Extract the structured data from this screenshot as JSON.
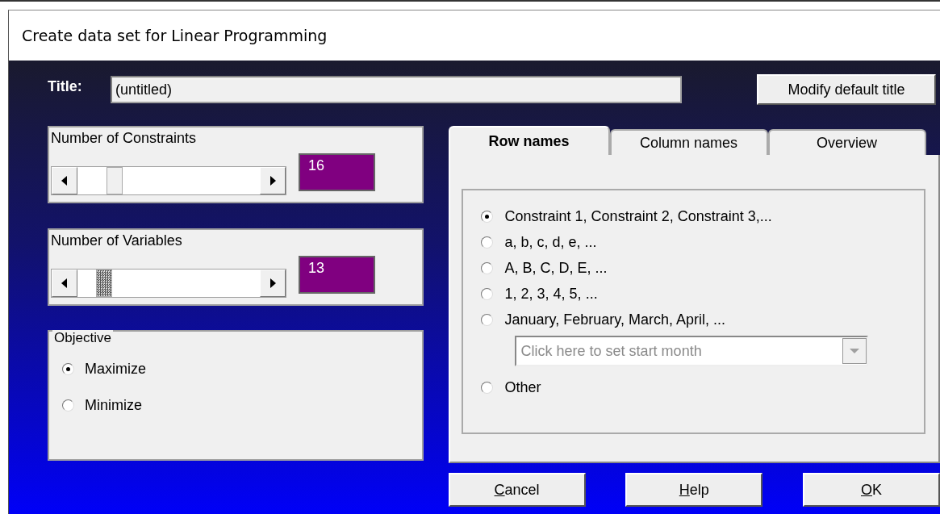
{
  "window": {
    "title": "Create data set for Linear Programming"
  },
  "title_field": {
    "label": "Title:",
    "value": "(untitled)"
  },
  "modify_button": "Modify default title",
  "sliders": [
    {
      "label": "Number of Constraints",
      "level": 0.16,
      "focused": false,
      "value": "16"
    },
    {
      "label": "Number of Variables",
      "level": 0.1,
      "focused": true,
      "value": "13"
    }
  ],
  "objective": {
    "legend": "Objective",
    "options": [
      {
        "label": "Maximize",
        "selected": true
      },
      {
        "label": "Minimize",
        "selected": false
      }
    ]
  },
  "tabs": [
    {
      "label": "Row names",
      "selected": true
    },
    {
      "label": "Column names",
      "selected": false
    },
    {
      "label": "Overview",
      "selected": false
    }
  ],
  "row_name_options": [
    {
      "label": "Constraint 1, Constraint 2, Constraint 3,...",
      "selected": true
    },
    {
      "label": "a, b, c, d, e, ...",
      "selected": false
    },
    {
      "label": "A, B, C, D, E, ...",
      "selected": false
    },
    {
      "label": "1, 2, 3, 4, 5, ...",
      "selected": false
    },
    {
      "label": "January, February, March, April, ...",
      "selected": false,
      "dropdown": {
        "placeholder": "Click here to set start month",
        "disabled": true
      }
    },
    {
      "label": "Other",
      "selected": false
    }
  ],
  "buttons": [
    {
      "label": "Cancel",
      "underline_first": true
    },
    {
      "label": "Help",
      "underline_first": true
    },
    {
      "label": "OK",
      "underline_first": true
    }
  ]
}
